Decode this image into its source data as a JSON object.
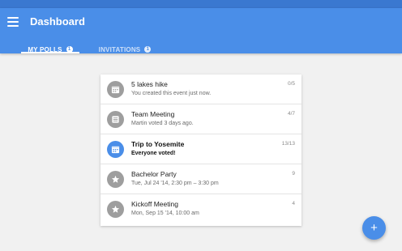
{
  "app": {
    "title": "Dashboard",
    "colors": {
      "primary": "#4a8ee8",
      "status_bar": "#3a78d0",
      "icon_inactive": "#9e9e9e"
    }
  },
  "tabs": [
    {
      "label": "MY POLLS",
      "badge": "1",
      "active": true
    },
    {
      "label": "INVITATIONS",
      "badge": "1",
      "active": false
    }
  ],
  "polls": [
    {
      "title": "5 lakes hike",
      "subtitle": "You created this event just now.",
      "count": "0/5",
      "icon": "calendar-icon"
    },
    {
      "title": "Team Meeting",
      "subtitle": "Martin voted 3 days ago.",
      "count": "4/7",
      "icon": "list-icon"
    },
    {
      "title": "Trip to Yosemite",
      "subtitle": "Everyone voted!",
      "count": "13/13",
      "icon": "calendar-icon"
    },
    {
      "title": "Bachelor Party",
      "subtitle": "Tue, Jul 24 '14, 2:30 pm – 3:30 pm",
      "count": "9",
      "icon": "star-icon"
    },
    {
      "title": "Kickoff Meeting",
      "subtitle": "Mon, Sep 15 '14, 10:00 am",
      "count": "4",
      "icon": "star-icon"
    }
  ],
  "fab": {
    "label": "+"
  }
}
